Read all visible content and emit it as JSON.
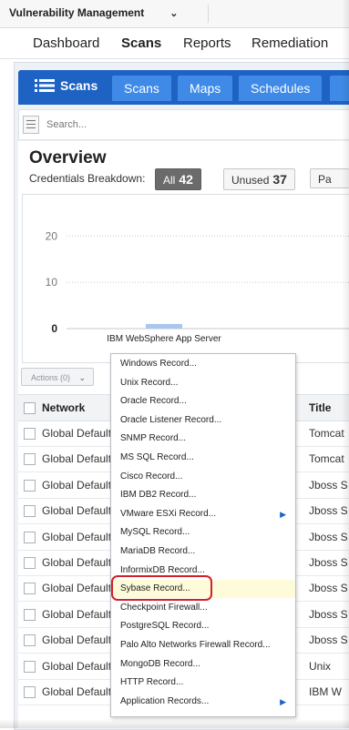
{
  "app": {
    "title": "Vulnerability Management"
  },
  "top_nav": [
    "Dashboard",
    "Scans",
    "Reports",
    "Remediation"
  ],
  "tabs": {
    "home": "Scans",
    "items": [
      "Scans",
      "Maps",
      "Schedules"
    ]
  },
  "search": {
    "placeholder": "Search..."
  },
  "overview": {
    "title": "Overview",
    "credentials_label": "Credentials Breakdown:",
    "filters": [
      {
        "label": "All",
        "count": "42"
      },
      {
        "label": "Unused",
        "count": "37"
      },
      {
        "label": "Pa",
        "count": ""
      }
    ]
  },
  "chart_data": {
    "type": "bar",
    "categories": [
      "IBM WebSphere App Server"
    ],
    "values": [
      1
    ],
    "ylim": [
      0,
      25
    ],
    "yticks": [
      "20",
      "10",
      "0"
    ],
    "grid": true,
    "colors": {
      "bar": "#a9c6ee",
      "grid": "#c9c9c9"
    }
  },
  "actions": {
    "label": "Actions (0)"
  },
  "table": {
    "headers": {
      "network": "Network",
      "title": "Title"
    },
    "rows": [
      {
        "network": "Global Default",
        "title": "Tomcat"
      },
      {
        "network": "Global Default",
        "title": "Tomcat"
      },
      {
        "network": "Global Default",
        "title": "Jboss S"
      },
      {
        "network": "Global Default",
        "title": "Jboss S"
      },
      {
        "network": "Global Default",
        "title": "Jboss S"
      },
      {
        "network": "Global Default",
        "title": "Jboss S"
      },
      {
        "network": "Global Default",
        "title": "Jboss S"
      },
      {
        "network": "Global Default",
        "title": "Jboss S"
      },
      {
        "network": "Global Default",
        "title": "Jboss S"
      },
      {
        "network": "Global Default",
        "title": "Unix"
      },
      {
        "network": "Global Default",
        "title": "IBM W"
      }
    ]
  },
  "menu": {
    "items": [
      {
        "label": "Windows Record...",
        "submenu": false,
        "highlighted": false
      },
      {
        "label": "Unix Record...",
        "submenu": false,
        "highlighted": false
      },
      {
        "label": "Oracle Record...",
        "submenu": false,
        "highlighted": false
      },
      {
        "label": "Oracle Listener Record...",
        "submenu": false,
        "highlighted": false
      },
      {
        "label": "SNMP Record...",
        "submenu": false,
        "highlighted": false
      },
      {
        "label": "MS SQL Record...",
        "submenu": false,
        "highlighted": false
      },
      {
        "label": "Cisco Record...",
        "submenu": false,
        "highlighted": false
      },
      {
        "label": "IBM DB2 Record...",
        "submenu": false,
        "highlighted": false
      },
      {
        "label": "VMware ESXi Record...",
        "submenu": true,
        "highlighted": false
      },
      {
        "label": "MySQL Record...",
        "submenu": false,
        "highlighted": false
      },
      {
        "label": "MariaDB Record...",
        "submenu": false,
        "highlighted": false
      },
      {
        "label": "InformixDB Record...",
        "submenu": false,
        "highlighted": false
      },
      {
        "label": "Sybase Record...",
        "submenu": false,
        "highlighted": true
      },
      {
        "label": "Checkpoint Firewall...",
        "submenu": false,
        "highlighted": false
      },
      {
        "label": "PostgreSQL Record...",
        "submenu": false,
        "highlighted": false
      },
      {
        "label": "Palo Alto Networks Firewall Record...",
        "submenu": false,
        "highlighted": false
      },
      {
        "label": "MongoDB Record...",
        "submenu": false,
        "highlighted": false
      },
      {
        "label": "HTTP Record...",
        "submenu": false,
        "highlighted": false
      },
      {
        "label": "Application Records...",
        "submenu": true,
        "highlighted": false
      }
    ],
    "highlight_ring_color": "#d0202b"
  },
  "colors": {
    "brand_blue": "#1e63c4",
    "tab_blue": "#3e8ae6"
  }
}
